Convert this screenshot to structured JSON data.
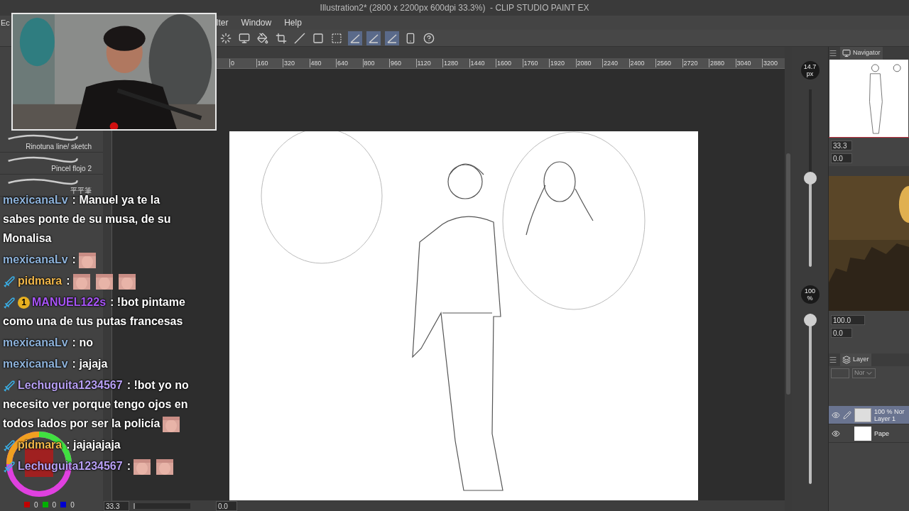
{
  "title": "Illustration2* (2800 x 2200px 600dpi 33.3%)  - CLIP STUDIO PAINT EX",
  "menu": [
    {
      "label": "Ec"
    },
    {
      "label": "lter"
    },
    {
      "label": "Window"
    },
    {
      "label": "Help"
    }
  ],
  "toolbar": [
    {
      "kind": "spinner",
      "selected": false
    },
    {
      "kind": "monitor",
      "selected": false
    },
    {
      "kind": "fill",
      "selected": false
    },
    {
      "kind": "crop",
      "selected": false
    },
    {
      "kind": "slash",
      "selected": false
    },
    {
      "kind": "square",
      "selected": false
    },
    {
      "kind": "frame",
      "selected": false
    },
    {
      "kind": "ruler",
      "selected": true
    },
    {
      "kind": "ruler",
      "selected": true
    },
    {
      "kind": "ruler",
      "selected": true
    },
    {
      "kind": "tablet",
      "selected": false
    },
    {
      "kind": "help",
      "selected": false
    }
  ],
  "ruler": {
    "labels": [
      "0",
      "160",
      "320",
      "480",
      "640",
      "800",
      "960",
      "1120",
      "1280",
      "1440",
      "1600",
      "1760",
      "1920",
      "2080",
      "2240",
      "2400",
      "2560",
      "2720",
      "2880",
      "3040",
      "3200"
    ]
  },
  "left_panel": {
    "brushes": [
      {
        "name": "Rinotuna line/ sketch"
      },
      {
        "name": "Pincel flojo 2"
      },
      {
        "name": "平平筆"
      }
    ],
    "color_values": [
      {
        "color": "#c00000",
        "value": "0"
      },
      {
        "color": "#00b000",
        "value": "0"
      },
      {
        "color": "#0000d0",
        "value": "0"
      }
    ]
  },
  "chat": [
    {
      "user": "mexicanaLv",
      "color": "#8fb4dc",
      "lines": [
        [
          {
            "kind": "text",
            "text": ": Manuel ya te la"
          }
        ],
        [
          {
            "kind": "text",
            "text": "sabes ponte de su musa, de su"
          }
        ],
        [
          {
            "kind": "text",
            "text": "Monalisa"
          }
        ]
      ]
    },
    {
      "user": "mexicanaLv",
      "color": "#8fb4dc",
      "lines": [
        [
          {
            "kind": "text",
            "text": ":"
          },
          {
            "kind": "emote"
          }
        ]
      ]
    },
    {
      "user": "pidmara",
      "color": "#f2b84b",
      "badges": [
        {
          "kind": "sword"
        }
      ],
      "lines": [
        [
          {
            "kind": "text",
            "text": ":"
          },
          {
            "kind": "emote"
          },
          {
            "kind": "emote"
          },
          {
            "kind": "emote"
          }
        ]
      ]
    },
    {
      "user": "MANUEL122s",
      "color": "#a855f7",
      "badges": [
        {
          "kind": "sword"
        },
        {
          "kind": "bits",
          "text": "1"
        }
      ],
      "lines": [
        [
          {
            "kind": "text",
            "text": ": !bot pintame"
          }
        ],
        [
          {
            "kind": "text",
            "text": "como una de tus putas francesas"
          }
        ]
      ]
    },
    {
      "user": "mexicanaLv",
      "color": "#8fb4dc",
      "lines": [
        [
          {
            "kind": "text",
            "text": ": no"
          }
        ]
      ]
    },
    {
      "user": "mexicanaLv",
      "color": "#8fb4dc",
      "lines": [
        [
          {
            "kind": "text",
            "text": ": jajaja"
          }
        ]
      ]
    },
    {
      "user": "Lechuguita1234567",
      "color": "#b8a0f5",
      "badges": [
        {
          "kind": "sword"
        }
      ],
      "lines": [
        [
          {
            "kind": "text",
            "text": ": !bot yo no"
          }
        ],
        [
          {
            "kind": "text",
            "text": "necesito ver porque tengo ojos en"
          }
        ],
        [
          {
            "kind": "text",
            "text": "todos lados por ser la policía"
          },
          {
            "kind": "emote"
          }
        ]
      ]
    },
    {
      "user": "pidmara",
      "color": "#f2b84b",
      "badges": [
        {
          "kind": "sword"
        }
      ],
      "lines": [
        [
          {
            "kind": "text",
            "text": ": jajajajaja"
          }
        ]
      ]
    },
    {
      "user": "Lechuguita1234567",
      "color": "#b8a0f5",
      "badges": [
        {
          "kind": "sword"
        }
      ],
      "lines": [
        [
          {
            "kind": "text",
            "text": ":"
          },
          {
            "kind": "emote"
          },
          {
            "kind": "emote"
          }
        ]
      ]
    }
  ],
  "size_slider": {
    "reading": "14.7",
    "unit": "px",
    "level": 0.5
  },
  "opacity_slider": {
    "reading": "100",
    "unit": "%",
    "level": 1
  },
  "navigator": {
    "tab": "Navigator",
    "zoom": "33.3",
    "angle": "0.0"
  },
  "subview": {
    "zoom": "100.0",
    "angle": "0.0"
  },
  "layer_panel": {
    "tab": "Layer",
    "blend": "Nor",
    "layers": [
      {
        "kind": "raster",
        "mode": "100 % Nor",
        "name": "Layer 1",
        "selected": true
      },
      {
        "kind": "paper",
        "name": "Pape",
        "selected": false
      }
    ]
  },
  "status": {
    "zoom": "33.3",
    "angle": "0.0",
    "level": 0.03
  }
}
